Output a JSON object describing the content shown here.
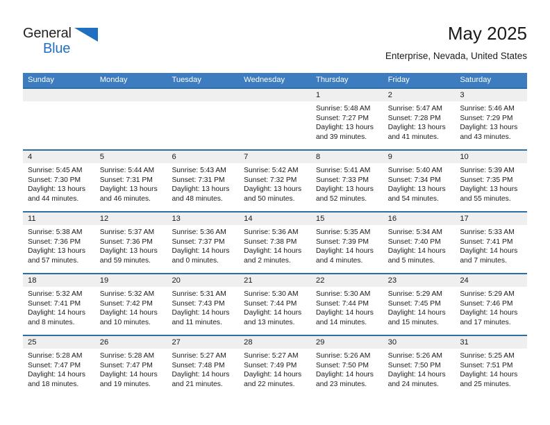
{
  "brand": {
    "name_part1": "General",
    "name_part2": "Blue",
    "triangle_color": "#1f70c1"
  },
  "header": {
    "title": "May 2025",
    "subtitle": "Enterprise, Nevada, United States"
  },
  "theme": {
    "header_bg": "#3c7cbf",
    "week_border": "#2e6da4",
    "daynum_bg": "#efefef",
    "text": "#1a1a1a"
  },
  "weekdays": [
    "Sunday",
    "Monday",
    "Tuesday",
    "Wednesday",
    "Thursday",
    "Friday",
    "Saturday"
  ],
  "weeks": [
    [
      {
        "day": "",
        "sunrise": "",
        "sunset": "",
        "daylight1": "",
        "daylight2": ""
      },
      {
        "day": "",
        "sunrise": "",
        "sunset": "",
        "daylight1": "",
        "daylight2": ""
      },
      {
        "day": "",
        "sunrise": "",
        "sunset": "",
        "daylight1": "",
        "daylight2": ""
      },
      {
        "day": "",
        "sunrise": "",
        "sunset": "",
        "daylight1": "",
        "daylight2": ""
      },
      {
        "day": "1",
        "sunrise": "Sunrise: 5:48 AM",
        "sunset": "Sunset: 7:27 PM",
        "daylight1": "Daylight: 13 hours",
        "daylight2": "and 39 minutes."
      },
      {
        "day": "2",
        "sunrise": "Sunrise: 5:47 AM",
        "sunset": "Sunset: 7:28 PM",
        "daylight1": "Daylight: 13 hours",
        "daylight2": "and 41 minutes."
      },
      {
        "day": "3",
        "sunrise": "Sunrise: 5:46 AM",
        "sunset": "Sunset: 7:29 PM",
        "daylight1": "Daylight: 13 hours",
        "daylight2": "and 43 minutes."
      }
    ],
    [
      {
        "day": "4",
        "sunrise": "Sunrise: 5:45 AM",
        "sunset": "Sunset: 7:30 PM",
        "daylight1": "Daylight: 13 hours",
        "daylight2": "and 44 minutes."
      },
      {
        "day": "5",
        "sunrise": "Sunrise: 5:44 AM",
        "sunset": "Sunset: 7:31 PM",
        "daylight1": "Daylight: 13 hours",
        "daylight2": "and 46 minutes."
      },
      {
        "day": "6",
        "sunrise": "Sunrise: 5:43 AM",
        "sunset": "Sunset: 7:31 PM",
        "daylight1": "Daylight: 13 hours",
        "daylight2": "and 48 minutes."
      },
      {
        "day": "7",
        "sunrise": "Sunrise: 5:42 AM",
        "sunset": "Sunset: 7:32 PM",
        "daylight1": "Daylight: 13 hours",
        "daylight2": "and 50 minutes."
      },
      {
        "day": "8",
        "sunrise": "Sunrise: 5:41 AM",
        "sunset": "Sunset: 7:33 PM",
        "daylight1": "Daylight: 13 hours",
        "daylight2": "and 52 minutes."
      },
      {
        "day": "9",
        "sunrise": "Sunrise: 5:40 AM",
        "sunset": "Sunset: 7:34 PM",
        "daylight1": "Daylight: 13 hours",
        "daylight2": "and 54 minutes."
      },
      {
        "day": "10",
        "sunrise": "Sunrise: 5:39 AM",
        "sunset": "Sunset: 7:35 PM",
        "daylight1": "Daylight: 13 hours",
        "daylight2": "and 55 minutes."
      }
    ],
    [
      {
        "day": "11",
        "sunrise": "Sunrise: 5:38 AM",
        "sunset": "Sunset: 7:36 PM",
        "daylight1": "Daylight: 13 hours",
        "daylight2": "and 57 minutes."
      },
      {
        "day": "12",
        "sunrise": "Sunrise: 5:37 AM",
        "sunset": "Sunset: 7:36 PM",
        "daylight1": "Daylight: 13 hours",
        "daylight2": "and 59 minutes."
      },
      {
        "day": "13",
        "sunrise": "Sunrise: 5:36 AM",
        "sunset": "Sunset: 7:37 PM",
        "daylight1": "Daylight: 14 hours",
        "daylight2": "and 0 minutes."
      },
      {
        "day": "14",
        "sunrise": "Sunrise: 5:36 AM",
        "sunset": "Sunset: 7:38 PM",
        "daylight1": "Daylight: 14 hours",
        "daylight2": "and 2 minutes."
      },
      {
        "day": "15",
        "sunrise": "Sunrise: 5:35 AM",
        "sunset": "Sunset: 7:39 PM",
        "daylight1": "Daylight: 14 hours",
        "daylight2": "and 4 minutes."
      },
      {
        "day": "16",
        "sunrise": "Sunrise: 5:34 AM",
        "sunset": "Sunset: 7:40 PM",
        "daylight1": "Daylight: 14 hours",
        "daylight2": "and 5 minutes."
      },
      {
        "day": "17",
        "sunrise": "Sunrise: 5:33 AM",
        "sunset": "Sunset: 7:41 PM",
        "daylight1": "Daylight: 14 hours",
        "daylight2": "and 7 minutes."
      }
    ],
    [
      {
        "day": "18",
        "sunrise": "Sunrise: 5:32 AM",
        "sunset": "Sunset: 7:41 PM",
        "daylight1": "Daylight: 14 hours",
        "daylight2": "and 8 minutes."
      },
      {
        "day": "19",
        "sunrise": "Sunrise: 5:32 AM",
        "sunset": "Sunset: 7:42 PM",
        "daylight1": "Daylight: 14 hours",
        "daylight2": "and 10 minutes."
      },
      {
        "day": "20",
        "sunrise": "Sunrise: 5:31 AM",
        "sunset": "Sunset: 7:43 PM",
        "daylight1": "Daylight: 14 hours",
        "daylight2": "and 11 minutes."
      },
      {
        "day": "21",
        "sunrise": "Sunrise: 5:30 AM",
        "sunset": "Sunset: 7:44 PM",
        "daylight1": "Daylight: 14 hours",
        "daylight2": "and 13 minutes."
      },
      {
        "day": "22",
        "sunrise": "Sunrise: 5:30 AM",
        "sunset": "Sunset: 7:44 PM",
        "daylight1": "Daylight: 14 hours",
        "daylight2": "and 14 minutes."
      },
      {
        "day": "23",
        "sunrise": "Sunrise: 5:29 AM",
        "sunset": "Sunset: 7:45 PM",
        "daylight1": "Daylight: 14 hours",
        "daylight2": "and 15 minutes."
      },
      {
        "day": "24",
        "sunrise": "Sunrise: 5:29 AM",
        "sunset": "Sunset: 7:46 PM",
        "daylight1": "Daylight: 14 hours",
        "daylight2": "and 17 minutes."
      }
    ],
    [
      {
        "day": "25",
        "sunrise": "Sunrise: 5:28 AM",
        "sunset": "Sunset: 7:47 PM",
        "daylight1": "Daylight: 14 hours",
        "daylight2": "and 18 minutes."
      },
      {
        "day": "26",
        "sunrise": "Sunrise: 5:28 AM",
        "sunset": "Sunset: 7:47 PM",
        "daylight1": "Daylight: 14 hours",
        "daylight2": "and 19 minutes."
      },
      {
        "day": "27",
        "sunrise": "Sunrise: 5:27 AM",
        "sunset": "Sunset: 7:48 PM",
        "daylight1": "Daylight: 14 hours",
        "daylight2": "and 21 minutes."
      },
      {
        "day": "28",
        "sunrise": "Sunrise: 5:27 AM",
        "sunset": "Sunset: 7:49 PM",
        "daylight1": "Daylight: 14 hours",
        "daylight2": "and 22 minutes."
      },
      {
        "day": "29",
        "sunrise": "Sunrise: 5:26 AM",
        "sunset": "Sunset: 7:50 PM",
        "daylight1": "Daylight: 14 hours",
        "daylight2": "and 23 minutes."
      },
      {
        "day": "30",
        "sunrise": "Sunrise: 5:26 AM",
        "sunset": "Sunset: 7:50 PM",
        "daylight1": "Daylight: 14 hours",
        "daylight2": "and 24 minutes."
      },
      {
        "day": "31",
        "sunrise": "Sunrise: 5:25 AM",
        "sunset": "Sunset: 7:51 PM",
        "daylight1": "Daylight: 14 hours",
        "daylight2": "and 25 minutes."
      }
    ]
  ]
}
